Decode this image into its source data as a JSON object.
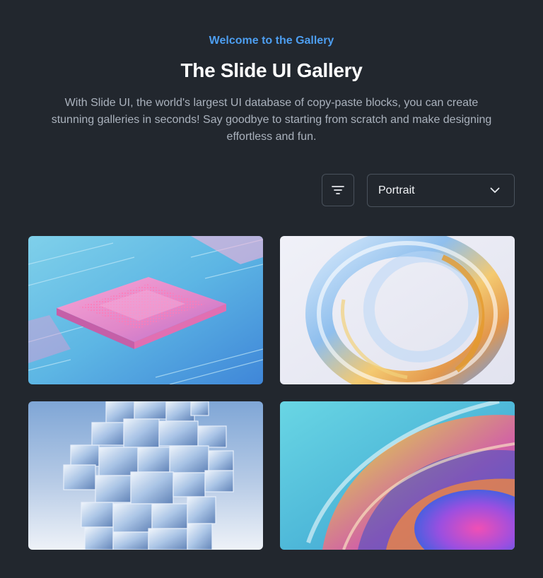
{
  "header": {
    "eyebrow": "Welcome to the Gallery",
    "title": "The Slide UI Gallery",
    "description": "With Slide UI, the world's largest UI database of copy-paste blocks, you can create stunning galleries in seconds! Say goodbye to starting from scratch and make designing effortless and fun."
  },
  "toolbar": {
    "filter_icon": "filter-lines-icon",
    "orientation_select": {
      "selected": "Portrait",
      "icon": "chevron-down-icon"
    }
  },
  "gallery": {
    "images": [
      {
        "subject": "microchip-circuit-board",
        "accent": "#f29bd6"
      },
      {
        "subject": "glass-ring-sculpture",
        "accent": "#f3b24a"
      },
      {
        "subject": "glass-cube-tower",
        "accent": "#9fc3f0"
      },
      {
        "subject": "iridescent-swirl",
        "accent": "#e8539e"
      }
    ]
  },
  "colors": {
    "background": "#22272e",
    "accent": "#4d9ef0",
    "heading": "#ffffff",
    "body_text": "#aab2bd",
    "border": "#4a525c"
  }
}
